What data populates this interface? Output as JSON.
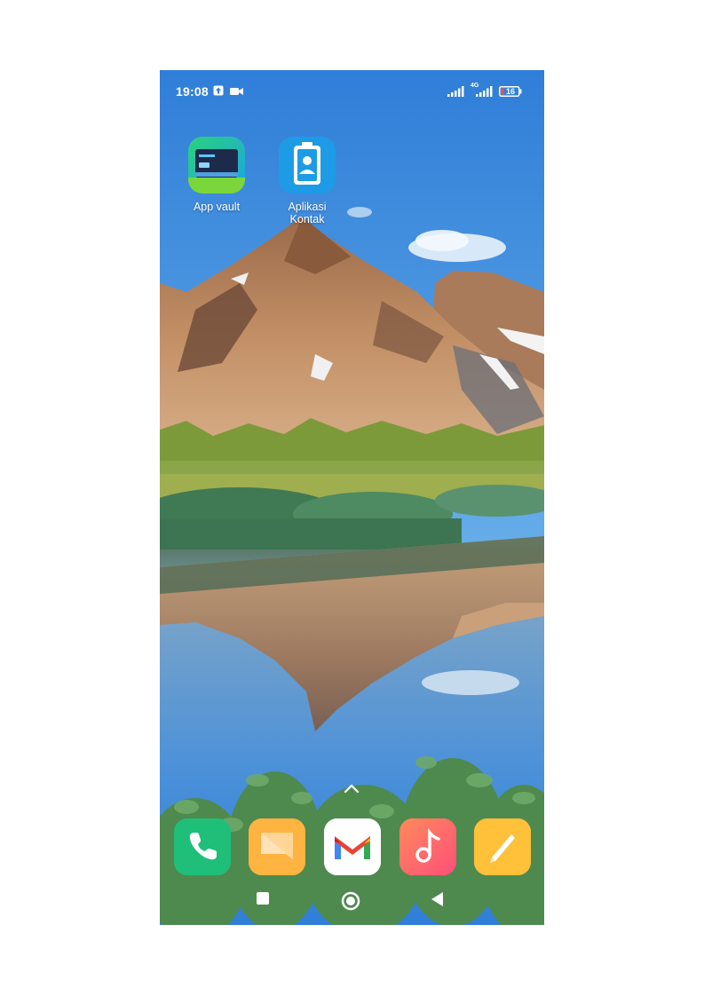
{
  "status_bar": {
    "time": "19:08",
    "network_label": "4G",
    "battery_level": "16",
    "icons": [
      "upload-arrow-icon",
      "video-camera-icon",
      "signal-icon",
      "signal-icon",
      "battery-icon"
    ]
  },
  "home_apps": [
    {
      "label": "App vault",
      "icon": "app-vault-icon"
    },
    {
      "label": "Aplikasi\nKontak",
      "label_line1": "Aplikasi",
      "label_line2": "Kontak",
      "icon": "contacts-icon"
    }
  ],
  "dock": [
    {
      "name": "phone",
      "icon": "phone-icon",
      "color": "#1fbf7a"
    },
    {
      "name": "messages",
      "icon": "messages-icon",
      "color": "#ffb340"
    },
    {
      "name": "gmail",
      "icon": "gmail-icon",
      "color": "#ffffff"
    },
    {
      "name": "music",
      "icon": "music-icon",
      "color": "#ff6a6a"
    },
    {
      "name": "notes",
      "icon": "notes-icon",
      "color": "#ffc03a"
    }
  ],
  "navigation": [
    "recents-square-icon",
    "home-circle-icon",
    "back-triangle-icon"
  ]
}
